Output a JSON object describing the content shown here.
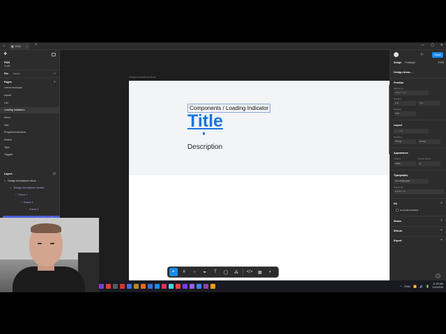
{
  "window": {
    "tab_title": "FDS",
    "tab_close": "×",
    "new_tab": "+",
    "controls": [
      "—",
      "▢",
      "✕"
    ]
  },
  "left_panel": {
    "file_name": "FDS",
    "file_sub": "Drafts",
    "tabs": {
      "file": "File",
      "assets": "Assets"
    },
    "pages_heading": "Pages",
    "pages": [
      "cursor-mockups",
      "Inputs",
      "List",
      "Loading Indicators",
      "Menu",
      "Nav",
      "Progress indicators",
      "Sliders",
      "Tabs",
      "Toggles"
    ],
    "selected_page_index": 3,
    "layers_heading": "Layers",
    "layers": [
      "Design Annotations Mock",
      "Design Annotations Header",
      "Frame 1",
      "Frame 3",
      "Frame 2"
    ],
    "selected_layer": "Annotations / Des"
  },
  "canvas": {
    "frame_label": "Design Annotations Mock",
    "component_path": "Components / Loading Indicator",
    "title": "Title",
    "description": "Description"
  },
  "toolbar": {
    "tools": [
      {
        "name": "move-tool",
        "glyph": "⌖",
        "active": true
      },
      {
        "name": "frame-tool",
        "glyph": "#",
        "active": false
      },
      {
        "name": "shape-tool",
        "glyph": "○",
        "active": false
      },
      {
        "name": "pen-tool",
        "glyph": "✒",
        "active": false
      },
      {
        "name": "text-tool",
        "glyph": "T",
        "active": false
      },
      {
        "name": "comment-tool",
        "glyph": "◯",
        "active": false
      },
      {
        "name": "actions-tool",
        "glyph": "⁂",
        "active": false
      },
      {
        "name": "dev-mode-toggle",
        "glyph": "</>",
        "active": false
      },
      {
        "name": "grid-toggle",
        "glyph": "▦",
        "active": false
      },
      {
        "name": "settings-toggle",
        "glyph": "◐",
        "active": false
      }
    ]
  },
  "right_panel": {
    "share_label": "Share",
    "tabs": {
      "design": "Design",
      "prototype": "Prototype"
    },
    "zoom": "372%",
    "selection_name": "Design Anno...",
    "position": {
      "heading": "Position",
      "alignment": "Alignment",
      "pos_label": "Position",
      "x": "X  0",
      "y": "Y  0",
      "rotation_label": "Rotation",
      "rotation": "⟲  0°"
    },
    "layout": {
      "heading": "Layout",
      "resizing": "Resizing",
      "w": "W  Hug",
      "h": "H  Hug"
    },
    "appearance": {
      "heading": "Appearance",
      "opacity_label": "Opacity",
      "corner_label": "Corner radius",
      "opacity": "100%",
      "corner": "0"
    },
    "typography": {
      "heading": "Typography",
      "style": "Text XS/Regular",
      "alignment": "Alignment"
    },
    "fill": {
      "heading": "Fill",
      "value": "General/text/default",
      "swatch_color": "#000000"
    },
    "stroke_heading": "Stroke",
    "effects_heading": "Effects",
    "export_heading": "Export",
    "help": "?"
  },
  "taskbar": {
    "tray": [
      "^",
      "ENG",
      "📶",
      "🔊",
      "🔋"
    ],
    "time": "11:30 AM",
    "date": "1/12/2026",
    "app_colors": [
      "#7a3ccf",
      "#e03a3a",
      "#5a5a5a",
      "#d33",
      "#3a6fd6",
      "#bd8a2b",
      "#e56b1f",
      "#3a6fd6",
      "#1b8cf1",
      "#e3305d",
      "#4dd0e1",
      "#e44",
      "#7c3aed",
      "#9b5de5",
      "#3b82f6",
      "#8e44ad",
      "#f59e0b"
    ]
  },
  "colors": {
    "accent": "#1b8cf1",
    "title_blue": "#1677e0",
    "selection": "#4f5fd6",
    "layer_purple": "#b39cf2"
  }
}
